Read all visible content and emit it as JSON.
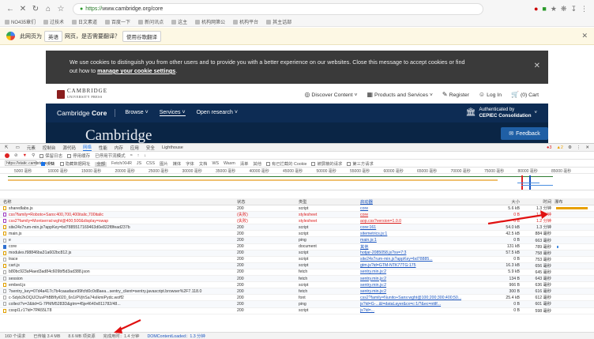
{
  "browser": {
    "url_scheme": "https://",
    "url_host": "www.cambridge.org/core",
    "bookmarks": [
      "NO435章们",
      "过技术",
      "日文素道",
      "百度一下",
      "新问讯点",
      "这主",
      "机构网第公",
      "机构平台",
      "其主话部"
    ]
  },
  "translate": {
    "message_pre": "此网页为",
    "source_lang": "英语",
    "message_mid": "网页，是否需要翻译？",
    "translate_button": "使用谷歌翻译"
  },
  "cookie": {
    "line1": "We use cookies to distinguish you from other users and to provide you with a better experience on our websites. Close this message to accept cookies or find",
    "line2_pre": "out how to ",
    "link": "manage your cookie settings",
    "line2_post": "."
  },
  "cup": {
    "logo_main": "CAMBRIDGE",
    "logo_sub": "UNIVERSITY PRESS",
    "discover": "Discover Content",
    "products": "Products and Services",
    "register": "Register",
    "login": "Log In",
    "cart": "(0) Cart"
  },
  "core": {
    "logo_a": "Cambridge",
    "logo_b": " Core",
    "nav": [
      "Browse",
      "Services",
      "Open research"
    ],
    "auth_line1": "Authenticated by",
    "auth_line2": "CEPIEC Consolidation",
    "hero_title": "Cambridge",
    "feedback": "Feedback"
  },
  "devtools": {
    "tabs": [
      "元素",
      "控制台",
      "源代码",
      "网络",
      "性能",
      "内存",
      "应用",
      "安全",
      "Lighthouse"
    ],
    "active_tab": "网络",
    "errors": "3",
    "warnings": "2",
    "controls": [
      "保留日志",
      "停用缓存",
      "已停用节流模式"
    ],
    "filter_value": "https://static.cambridge.org",
    "filter_opts": [
      "反转",
      "隐藏数据网址",
      "全部"
    ],
    "types": [
      "Fetch/XHR",
      "JS",
      "CSS",
      "图片",
      "媒体",
      "字体",
      "文档",
      "WS",
      "Wasm",
      "清单",
      "其他"
    ],
    "filter_tail": [
      "有已拦截的 Cookie",
      "被屏蔽的请求",
      "第三方请求"
    ],
    "ticks": [
      "5000 毫秒",
      "10000 毫秒",
      "15000 毫秒",
      "20000 毫秒",
      "25000 毫秒",
      "30000 毫秒",
      "35000 毫秒",
      "40000 毫秒",
      "45000 毫秒",
      "50000 毫秒",
      "55000 毫秒",
      "60000 毫秒",
      "65000 毫秒",
      "70000 毫秒",
      "75000 毫秒",
      "80000 毫秒",
      "85000 毫秒"
    ],
    "columns": [
      "名称",
      "状态",
      "类型",
      "启动器",
      "大小",
      "时间",
      "瀑布"
    ],
    "rows": [
      {
        "name": "sharedlabs.js",
        "status": "200",
        "type": "script",
        "initiator": "core",
        "size": "5.6 kB",
        "time": "1.3 分钟",
        "err": false,
        "kind": "js"
      },
      {
        "name": "css?family=Roboto+Sans:400,700,400italic,700italic",
        "status": "(失败)",
        "type": "stylesheet",
        "initiator": "core",
        "size": "0 B",
        "time": "1.2 分钟",
        "err": true,
        "kind": "css"
      },
      {
        "name": "css2?family=Montserrat:wght@400;500&display=swap",
        "status": "(失败)",
        "type": "stylesheet",
        "initiator": "aop.css?version=1.0.0",
        "size": "0 B",
        "time": "1.2 分钟",
        "err": true,
        "kind": "css"
      },
      {
        "name": "site24x7rum-min.js?appKey=bd7885517169463d0e822f8fead237b",
        "status": "200",
        "type": "script",
        "initiator": "core:161",
        "size": "54.0 kB",
        "time": "1.3 分钟",
        "err": false,
        "kind": "js"
      },
      {
        "name": "main.js",
        "status": "200",
        "type": "script",
        "initiator": "sitemetrics.js:1",
        "size": "42.5 kB",
        "time": "884 毫秒",
        "err": false,
        "kind": "js"
      },
      {
        "name": "e",
        "status": "200",
        "type": "ping",
        "initiator": "main.js:1",
        "size": "0 B",
        "time": "663 毫秒",
        "err": false,
        "kind": "other"
      },
      {
        "name": "core",
        "status": "200",
        "type": "document",
        "initiator": "其他",
        "size": "131 kB",
        "time": "789 毫秒",
        "err": false,
        "kind": "doc"
      },
      {
        "name": "modules.f98846ba31a602bc812.js",
        "status": "200",
        "type": "script",
        "initiator": "hotjar-2085058.js?sv=7:3",
        "size": "57.5 kB",
        "time": "758 毫秒",
        "err": false,
        "kind": "js"
      },
      {
        "name": "trace",
        "status": "200",
        "type": "script",
        "initiator": "site24x7rum-min.js?appKey=bd78885...",
        "size": "0 B",
        "time": "753 毫秒",
        "err": false,
        "kind": "other"
      },
      {
        "name": "cart.js",
        "status": "200",
        "type": "script",
        "initiator": "gtm.js?id=GTM-NTK77TG:175",
        "size": "16.3 kB",
        "time": "656 毫秒",
        "err": false,
        "kind": "js"
      },
      {
        "name": "b80bc923af4aed3ad84c609bf5d3ad388.json",
        "status": "200",
        "type": "fetch",
        "initiator": "sentry.min.js:2",
        "size": "5.9 kB",
        "time": "645 毫秒",
        "err": false,
        "kind": "other"
      },
      {
        "name": "session",
        "status": "200",
        "type": "fetch",
        "initiator": "sentry.min.js:2",
        "size": "134 B",
        "time": "643 毫秒",
        "err": false,
        "kind": "other"
      },
      {
        "name": "embed.js",
        "status": "200",
        "type": "script",
        "initiator": "sentry.min.js:2",
        "size": "966 B",
        "time": "636 毫秒",
        "err": false,
        "kind": "js"
      },
      {
        "name": "?sentry_key=07d4a417c7b4caaaface99fcfd0c0d8aea...sentry_client=sentry.javascript.browser%2F7.118.0",
        "status": "200",
        "type": "fetch",
        "initiator": "sentry.min.js:2",
        "size": "300 B",
        "time": "616 毫秒",
        "err": false,
        "kind": "other"
      },
      {
        "name": "c-Sdyb2kOQlJCfuvPhBBfIyi020_6n1iPVjhSa74sIkmiPydc.woff2",
        "status": "200",
        "type": "font",
        "initiator": "css2?family=Nunito+Sans:wght@100;200;300;400;50...",
        "size": "25.4 kB",
        "time": "612 毫秒",
        "err": false,
        "kind": "other"
      },
      {
        "name": "collect?v=2&tid=G-7PMM5283D&gtm=45je4640v811782/48...",
        "status": "200",
        "type": "ping",
        "initiator": "js?id=G-...&l=dataLayer&cx=c:1/?&ec=nttlf...",
        "size": "0 B",
        "time": "601 毫秒",
        "err": false,
        "kind": "other"
      },
      {
        "name": "csspl1.r1?id=7PA55LT8",
        "status": "200",
        "type": "script",
        "initiator": "js?id=...",
        "size": "0 B",
        "time": "598 毫秒",
        "err": false,
        "kind": "js"
      }
    ],
    "status_bar": [
      "160 个请求",
      "已传输 3.4 MB",
      "8.6 MB 项资源",
      "完成用时：1.4 分钟",
      "DOMContentLoaded：1.3 分钟"
    ]
  }
}
